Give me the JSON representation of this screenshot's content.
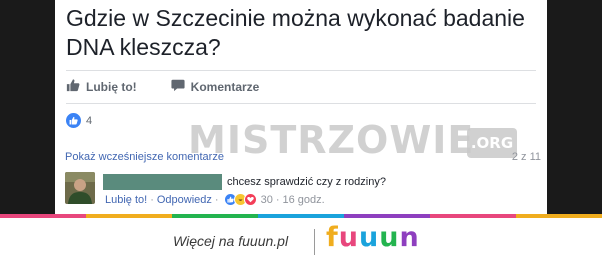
{
  "post": {
    "title": "Gdzie w Szczecinie można wykonać badanie DNA kleszcza?",
    "actions": {
      "like_label": "Lubię to!",
      "comment_label": "Komentarze"
    },
    "reactions": {
      "icon": "thumbs-up-icon",
      "count": "4"
    }
  },
  "watermark": {
    "text": "MISTRZOWIE",
    "suffix": ".ORG"
  },
  "comments": {
    "show_previous": "Pokaż wcześniejsze komentarze",
    "counter": "2 z 11",
    "comment": {
      "text": "chcesz sprawdzić czy z rodziny?",
      "like_label": "Lubię to!",
      "reply_label": "Odpowiedz",
      "reaction_count": "30",
      "time": "16 godz."
    }
  },
  "footer": {
    "tagline": "Więcej na fuuun.pl",
    "logo_letters": [
      "f",
      "u",
      "u",
      "u",
      "n"
    ],
    "logo_colors": [
      "#f0ad1e",
      "#e8477d",
      "#1aa3dc",
      "#23b44f",
      "#8e3fbf"
    ],
    "stripe_colors": [
      "#e8477d",
      "#f0ad1e",
      "#23b44f",
      "#1aa3dc",
      "#8e3fbf",
      "#e8477d",
      "#f0ad1e"
    ]
  },
  "colors": {
    "link": "#4267b2",
    "like_blue": "#3b83f5",
    "background_dark": "#1a1a1a"
  }
}
